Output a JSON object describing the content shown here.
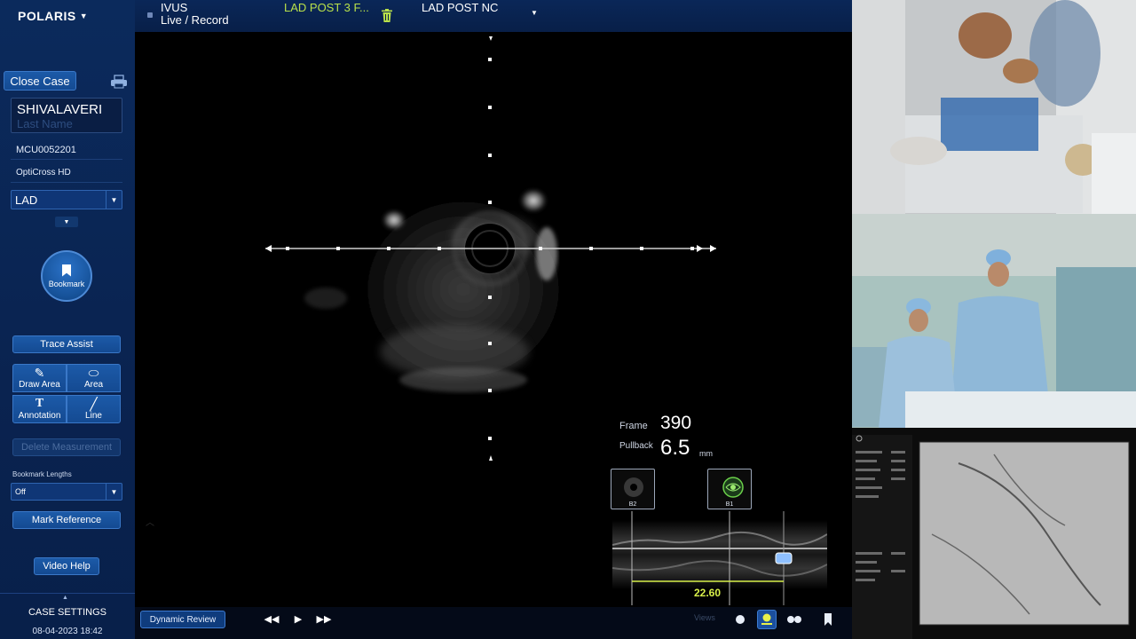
{
  "sidebar": {
    "brand": "POLARIS",
    "close_case": "Close Case",
    "patient_first": "SHIVALAVERI",
    "patient_last_placeholder": "Last Name",
    "case_id": "MCU0052201",
    "catheter": "OptiCross HD",
    "vessel": "LAD",
    "bookmark": "Bookmark",
    "trace_assist": "Trace Assist",
    "tools": {
      "draw_area": "Draw Area",
      "area": "Area",
      "annotation": "Annotation",
      "line": "Line"
    },
    "delete_measurement": "Delete Measurement",
    "bookmark_lengths_label": "Bookmark Lengths",
    "bookmark_lengths_value": "Off",
    "mark_reference": "Mark Reference",
    "video_help": "Video Help",
    "case_settings": "CASE SETTINGS",
    "datetime": "08-04-2023 18:42"
  },
  "topbar": {
    "mode_title": "IVUS",
    "mode_sub": "Live / Record",
    "run_current": "LAD POST 3 F...",
    "run_next": "LAD POST NC"
  },
  "ivus": {
    "frame_label": "Frame",
    "frame_value": "390",
    "pullback_label": "Pullback",
    "pullback_value": "6.5",
    "pullback_unit": "mm",
    "bookmarks": [
      {
        "label": "B2"
      },
      {
        "label": "B1"
      }
    ],
    "length_value": "22.60"
  },
  "bottombar": {
    "dynamic_review": "Dynamic Review",
    "views_label": "Views"
  },
  "colors": {
    "sidebar_bg": "#0b2a5c",
    "button_blue": "#1c5aa8",
    "accent_green": "#b8e04a",
    "measure_yellow": "#d8f04a"
  }
}
